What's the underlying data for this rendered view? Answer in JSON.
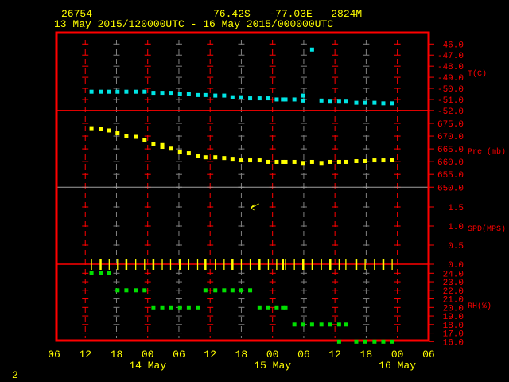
{
  "header": {
    "station_id": "26754",
    "location": "76.42S   -77.03E   2824M",
    "time_range": "13 May 2015/120000UTC - 16 May 2015/000000UTC"
  },
  "footer": {
    "page_number": "2"
  },
  "colors": {
    "frame": "#ff0000",
    "grid_alt": "#808080",
    "text": "#ffff00",
    "temperature": "#00e5e5",
    "pressure": "#ffff00",
    "wind": "#ffff00",
    "rh": "#00e000"
  },
  "chart_data": {
    "type": "scatter",
    "title": "26754  76.42S -77.03E 2824M",
    "x_unit": "hours since 13 May 2015 06UTC",
    "x_range": [
      0,
      72
    ],
    "x_tick_labels": [
      "06",
      "12",
      "18",
      "00",
      "06",
      "12",
      "18",
      "00",
      "06",
      "12",
      "18",
      "00",
      "06"
    ],
    "date_labels": [
      {
        "label": "14 May",
        "hour": 18
      },
      {
        "label": "15 May",
        "hour": 42
      },
      {
        "label": "16 May",
        "hour": 66
      }
    ],
    "panels": [
      {
        "name": "temperature",
        "ylabel": "T(C)",
        "ylim": [
          -52,
          -46
        ],
        "ticks": [
          "-46.0",
          "-47.0",
          "-48.0",
          "-49.0",
          "-50.0",
          "-51.0",
          "-52.0"
        ],
        "points": [
          [
            7.2,
            -50.3
          ],
          [
            8.95,
            -50.3
          ],
          [
            10.6,
            -50.3
          ],
          [
            12.2,
            -50.3
          ],
          [
            13.9,
            -50.3
          ],
          [
            15.7,
            -50.3
          ],
          [
            17.4,
            -50.3
          ],
          [
            19.1,
            -50.4
          ],
          [
            20.8,
            -50.4
          ],
          [
            22.4,
            -50.4
          ],
          [
            24.2,
            -50.5
          ],
          [
            25.9,
            -50.5
          ],
          [
            27.6,
            -50.6
          ],
          [
            29.1,
            -50.6
          ],
          [
            31.0,
            -50.65
          ],
          [
            32.7,
            -50.65
          ],
          [
            34.3,
            -50.8
          ],
          [
            36.0,
            -50.8
          ],
          [
            37.7,
            -50.9
          ],
          [
            39.5,
            -50.9
          ],
          [
            41.2,
            -50.9
          ],
          [
            42.8,
            -51.0
          ],
          [
            44.0,
            -51.0
          ],
          [
            44.5,
            -51.0
          ],
          [
            46.2,
            -51.0
          ],
          [
            47.9,
            -50.65
          ],
          [
            47.9,
            -51.1
          ],
          [
            49.6,
            -46.5
          ],
          [
            51.4,
            -51.1
          ],
          [
            53.1,
            -51.2
          ],
          [
            54.8,
            -51.2
          ],
          [
            56.1,
            -51.2
          ],
          [
            58.1,
            -51.3
          ],
          [
            59.8,
            -51.3
          ],
          [
            61.6,
            -51.3
          ],
          [
            63.3,
            -51.35
          ],
          [
            65.0,
            -51.35
          ]
        ]
      },
      {
        "name": "pressure",
        "ylabel": "Pre (mb)",
        "ylim": [
          650,
          675
        ],
        "ticks": [
          "675.0",
          "670.0",
          "665.0",
          "660.0",
          "655.0",
          "650.0"
        ],
        "points": [
          [
            7.2,
            673.1
          ],
          [
            8.95,
            672.8
          ],
          [
            10.6,
            672.2
          ],
          [
            12.2,
            671.1
          ],
          [
            13.9,
            670.1
          ],
          [
            15.7,
            669.7
          ],
          [
            17.4,
            668.3
          ],
          [
            19.1,
            667.0
          ],
          [
            20.8,
            666.5
          ],
          [
            20.8,
            665.8
          ],
          [
            22.4,
            665.1
          ],
          [
            24.2,
            663.9
          ],
          [
            25.9,
            663.3
          ],
          [
            27.6,
            662.3
          ],
          [
            29.1,
            661.7
          ],
          [
            31.0,
            661.7
          ],
          [
            32.7,
            661.4
          ],
          [
            34.3,
            661.1
          ],
          [
            36.0,
            660.5
          ],
          [
            37.7,
            660.5
          ],
          [
            39.5,
            660.5
          ],
          [
            41.2,
            659.9
          ],
          [
            42.8,
            659.9
          ],
          [
            44.0,
            659.9
          ],
          [
            44.5,
            659.9
          ],
          [
            46.2,
            659.9
          ],
          [
            47.9,
            659.5
          ],
          [
            49.6,
            659.9
          ],
          [
            51.4,
            659.5
          ],
          [
            53.1,
            659.9
          ],
          [
            54.8,
            659.9
          ],
          [
            56.1,
            659.9
          ],
          [
            58.1,
            660.2
          ],
          [
            59.8,
            660.2
          ],
          [
            61.6,
            660.5
          ],
          [
            63.3,
            660.5
          ],
          [
            65.0,
            660.8
          ]
        ]
      },
      {
        "name": "wind_speed",
        "ylabel": "SPD(MPS)",
        "ylim": [
          0,
          1.5
        ],
        "ticks": [
          "1.5",
          "1.0",
          "0.5",
          "0.0"
        ],
        "times": [
          7.2,
          8.95,
          10.6,
          12.2,
          13.9,
          15.7,
          17.4,
          19.1,
          20.8,
          22.4,
          24.2,
          25.9,
          27.6,
          29.1,
          31.0,
          32.7,
          34.3,
          36.0,
          37.7,
          39.5,
          41.2,
          42.8,
          44.0,
          44.5,
          46.2,
          47.9,
          49.6,
          51.4,
          53.1,
          54.8,
          56.1,
          58.1,
          59.8,
          61.6,
          63.3,
          65.0
        ],
        "values": [
          0,
          0,
          0,
          0,
          0,
          0,
          0,
          0,
          0,
          0,
          0,
          0,
          0,
          0,
          0,
          0,
          0,
          0,
          0,
          0,
          0,
          0,
          0,
          0,
          0,
          0,
          0,
          0,
          0,
          0,
          0,
          0,
          0,
          0,
          0,
          0
        ],
        "direction_marker": {
          "hour": 38,
          "speed": 1.5
        }
      },
      {
        "name": "relative_humidity",
        "ylabel": "RH(%)",
        "ylim": [
          16,
          24
        ],
        "ticks": [
          "24.0",
          "23.0",
          "22.0",
          "21.0",
          "20.0",
          "19.0",
          "18.0",
          "17.0",
          "16.0"
        ],
        "points": [
          [
            7.2,
            24
          ],
          [
            8.95,
            24
          ],
          [
            10.6,
            24
          ],
          [
            12.2,
            22
          ],
          [
            13.9,
            22
          ],
          [
            15.7,
            22
          ],
          [
            17.4,
            22
          ],
          [
            19.1,
            20
          ],
          [
            20.8,
            20
          ],
          [
            22.4,
            20
          ],
          [
            24.2,
            20
          ],
          [
            25.9,
            20
          ],
          [
            27.6,
            20
          ],
          [
            29.1,
            22
          ],
          [
            31.0,
            22
          ],
          [
            32.7,
            22
          ],
          [
            34.3,
            22
          ],
          [
            36.0,
            22
          ],
          [
            37.7,
            22
          ],
          [
            39.5,
            20
          ],
          [
            41.2,
            20
          ],
          [
            42.8,
            20
          ],
          [
            44.0,
            20
          ],
          [
            44.5,
            20
          ],
          [
            46.2,
            18
          ],
          [
            47.9,
            18
          ],
          [
            49.6,
            18
          ],
          [
            51.4,
            18
          ],
          [
            53.1,
            18
          ],
          [
            54.8,
            18
          ],
          [
            56.1,
            18
          ],
          [
            54.8,
            16
          ],
          [
            58.1,
            16
          ],
          [
            59.8,
            16
          ],
          [
            61.6,
            16
          ],
          [
            63.3,
            16
          ],
          [
            65.0,
            16
          ]
        ]
      }
    ]
  }
}
